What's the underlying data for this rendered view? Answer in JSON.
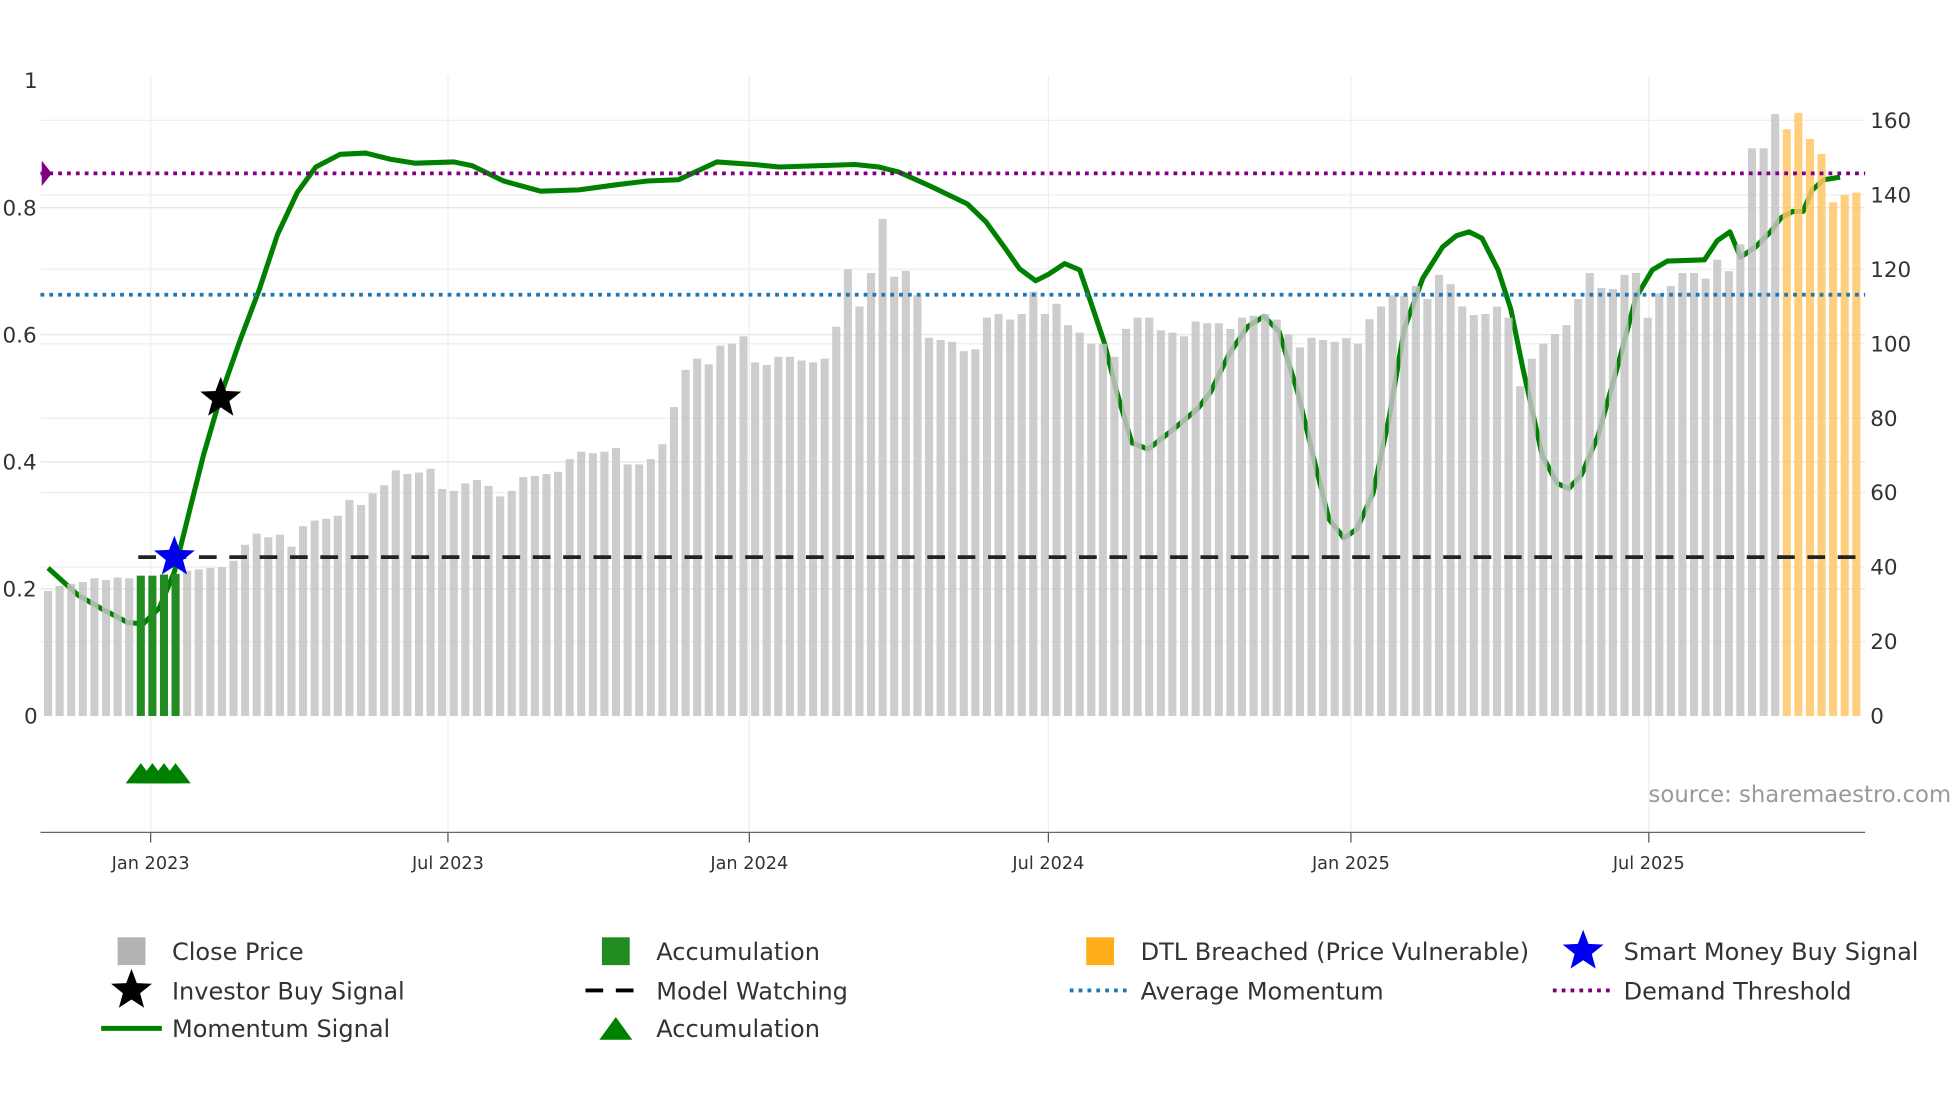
{
  "chart_data": {
    "type": "bar",
    "title": "",
    "left_axis": {
      "ticks": [
        0,
        0.2,
        0.4,
        0.6,
        0.8,
        1
      ],
      "labels": [
        "0",
        "0.2",
        "0.4",
        "0.6",
        "0.8",
        "1"
      ],
      "range": [
        -0.183,
        1
      ]
    },
    "right_axis": {
      "ticks": [
        0,
        20,
        40,
        60,
        80,
        100,
        120,
        140,
        160
      ],
      "labels": [
        "0",
        "20",
        "40",
        "60",
        "80",
        "100",
        "120",
        "140",
        "160"
      ],
      "range": [
        0,
        160
      ]
    },
    "x_ticks": [
      {
        "label": "Jan 2023",
        "week": 8.85
      },
      {
        "label": "Jul 2023",
        "week": 34.5
      },
      {
        "label": "Jan 2024",
        "week": 60.5
      },
      {
        "label": "Jul 2024",
        "week": 86.3
      },
      {
        "label": "Jan 2025",
        "week": 112.4
      },
      {
        "label": "Jul 2025",
        "week": 138.1
      }
    ],
    "close_price": [
      33.6,
      35,
      35.5,
      36,
      37,
      36.5,
      37.2,
      37,
      37.7,
      37.7,
      38,
      38.2,
      39,
      39.4,
      39.8,
      40,
      41.7,
      46,
      49,
      48,
      48.7,
      45.5,
      51,
      52.5,
      53,
      53.8,
      58,
      56.7,
      59.8,
      62,
      66,
      65,
      65.4,
      66.4,
      61,
      60.5,
      62.5,
      63.4,
      61.8,
      59,
      60.5,
      64.2,
      64.5,
      65,
      65.6,
      69,
      71,
      70.6,
      71,
      72,
      67.6,
      67.6,
      69,
      73,
      83,
      93,
      96,
      94.5,
      99.5,
      100,
      102,
      95,
      94.3,
      96.5,
      96.5,
      95.5,
      95,
      96,
      104.6,
      120,
      110,
      119,
      133.5,
      118,
      119.6,
      113,
      101.6,
      101,
      100.5,
      98,
      98.5,
      107,
      108,
      106.5,
      108,
      114,
      108,
      110.7,
      105,
      103,
      100,
      100,
      96.5,
      104,
      107,
      107,
      103.6,
      103,
      102,
      106,
      105.5,
      105.5,
      104,
      107,
      107.5,
      108,
      106.5,
      102.5,
      99,
      101.6,
      101,
      100.5,
      101.5,
      100,
      106.6,
      110,
      113,
      112.8,
      115.5,
      112,
      118.5,
      116,
      110,
      107.7,
      108,
      110,
      107,
      88.6,
      96,
      100,
      102.6,
      105,
      112,
      119,
      115,
      114.7,
      118.5,
      119,
      107,
      113.5,
      115.5,
      119,
      119,
      117.5,
      122.6,
      119.5,
      126.7,
      152.5,
      152.5,
      161.7,
      157.6,
      162,
      155,
      151,
      138,
      140,
      140.6
    ],
    "accumulation_bar_index": [
      8,
      9,
      10,
      11
    ],
    "dtl_breached_bar_index": [
      150,
      151,
      152,
      153,
      154,
      155,
      156
    ],
    "momentum": [
      [
        0,
        0.233
      ],
      [
        2.6,
        0.19
      ],
      [
        4.8,
        0.167
      ],
      [
        6.9,
        0.147
      ],
      [
        8.2,
        0.145
      ],
      [
        9.6,
        0.17
      ],
      [
        10.9,
        0.227
      ],
      [
        12.3,
        0.33
      ],
      [
        13.4,
        0.41
      ],
      [
        15,
        0.51
      ],
      [
        16.6,
        0.593
      ],
      [
        18.2,
        0.67
      ],
      [
        19.8,
        0.758
      ],
      [
        21.5,
        0.824
      ],
      [
        23.1,
        0.864
      ],
      [
        25.2,
        0.884
      ],
      [
        27.4,
        0.886
      ],
      [
        29.6,
        0.876
      ],
      [
        31.7,
        0.87
      ],
      [
        35,
        0.872
      ],
      [
        36.6,
        0.866
      ],
      [
        39.3,
        0.842
      ],
      [
        42.5,
        0.826
      ],
      [
        45.8,
        0.828
      ],
      [
        49,
        0.836
      ],
      [
        51.7,
        0.842
      ],
      [
        54.4,
        0.844
      ],
      [
        57.7,
        0.872
      ],
      [
        60.9,
        0.868
      ],
      [
        63.1,
        0.864
      ],
      [
        69.6,
        0.868
      ],
      [
        71.7,
        0.864
      ],
      [
        73.4,
        0.856
      ],
      [
        76.1,
        0.834
      ],
      [
        79.3,
        0.806
      ],
      [
        80.9,
        0.778
      ],
      [
        82.5,
        0.738
      ],
      [
        83.8,
        0.704
      ],
      [
        85.2,
        0.685
      ],
      [
        86.3,
        0.695
      ],
      [
        87.7,
        0.712
      ],
      [
        89,
        0.702
      ],
      [
        90,
        0.649
      ],
      [
        91.1,
        0.589
      ],
      [
        92.2,
        0.51
      ],
      [
        93.5,
        0.43
      ],
      [
        94.9,
        0.42
      ],
      [
        97,
        0.45
      ],
      [
        99.2,
        0.484
      ],
      [
        100.3,
        0.51
      ],
      [
        101.9,
        0.57
      ],
      [
        103.5,
        0.613
      ],
      [
        104.9,
        0.629
      ],
      [
        106.2,
        0.605
      ],
      [
        107.8,
        0.51
      ],
      [
        109.4,
        0.39
      ],
      [
        110.5,
        0.31
      ],
      [
        111.8,
        0.28
      ],
      [
        112.9,
        0.294
      ],
      [
        114.3,
        0.35
      ],
      [
        115.7,
        0.47
      ],
      [
        117,
        0.609
      ],
      [
        118.6,
        0.689
      ],
      [
        120.3,
        0.738
      ],
      [
        121.5,
        0.756
      ],
      [
        122.6,
        0.762
      ],
      [
        123.7,
        0.752
      ],
      [
        125.1,
        0.702
      ],
      [
        126.2,
        0.64
      ],
      [
        127.2,
        0.55
      ],
      [
        128.9,
        0.41
      ],
      [
        130.2,
        0.366
      ],
      [
        131.2,
        0.358
      ],
      [
        132.3,
        0.38
      ],
      [
        133.7,
        0.44
      ],
      [
        135.4,
        0.55
      ],
      [
        137,
        0.659
      ],
      [
        138.4,
        0.702
      ],
      [
        139.7,
        0.716
      ],
      [
        142.9,
        0.718
      ],
      [
        144,
        0.748
      ],
      [
        145.1,
        0.762
      ],
      [
        146,
        0.722
      ],
      [
        147.3,
        0.738
      ],
      [
        148.6,
        0.762
      ],
      [
        149.5,
        0.784
      ],
      [
        150.5,
        0.794
      ],
      [
        151.4,
        0.794
      ],
      [
        152.2,
        0.828
      ],
      [
        153.2,
        0.844
      ],
      [
        154.6,
        0.848
      ]
    ],
    "investor_buy_signal": [
      {
        "week": 14.9,
        "value": 0.5
      }
    ],
    "smart_money_buy_signal": [
      {
        "week": 10.9,
        "value": 0.25
      }
    ],
    "model_watching": {
      "value": 0.25,
      "from_week": 8
    },
    "average_momentum": 0.663,
    "demand_threshold": 0.854,
    "accumulation_markers": [
      {
        "week": 8,
        "value": -0.088
      },
      {
        "week": 9,
        "value": -0.088
      },
      {
        "week": 10,
        "value": -0.088
      },
      {
        "week": 11,
        "value": -0.088
      }
    ],
    "source": "source: sharemaestro.com",
    "legend": [
      {
        "label": "Close Price",
        "kind": "bar",
        "color": "#b3b3b3"
      },
      {
        "label": "Accumulation",
        "kind": "bar",
        "color": "#228b22"
      },
      {
        "label": "DTL Breached (Price Vulnerable)",
        "kind": "bar",
        "color": "#ffae1a"
      },
      {
        "label": "Smart Money Buy Signal",
        "kind": "star",
        "color": "#0000ee"
      },
      {
        "label": "Investor Buy Signal",
        "kind": "star",
        "color": "#000000"
      },
      {
        "label": "Model Watching",
        "kind": "dash",
        "color": "#000000"
      },
      {
        "label": "Average Momentum",
        "kind": "dot",
        "color": "#1f77b4"
      },
      {
        "label": "Demand Threshold",
        "kind": "dot",
        "color": "#800080"
      },
      {
        "label": "Momentum Signal",
        "kind": "line",
        "color": "#008000"
      },
      {
        "label": "Accumulation",
        "kind": "triangle",
        "color": "#008000"
      }
    ]
  }
}
